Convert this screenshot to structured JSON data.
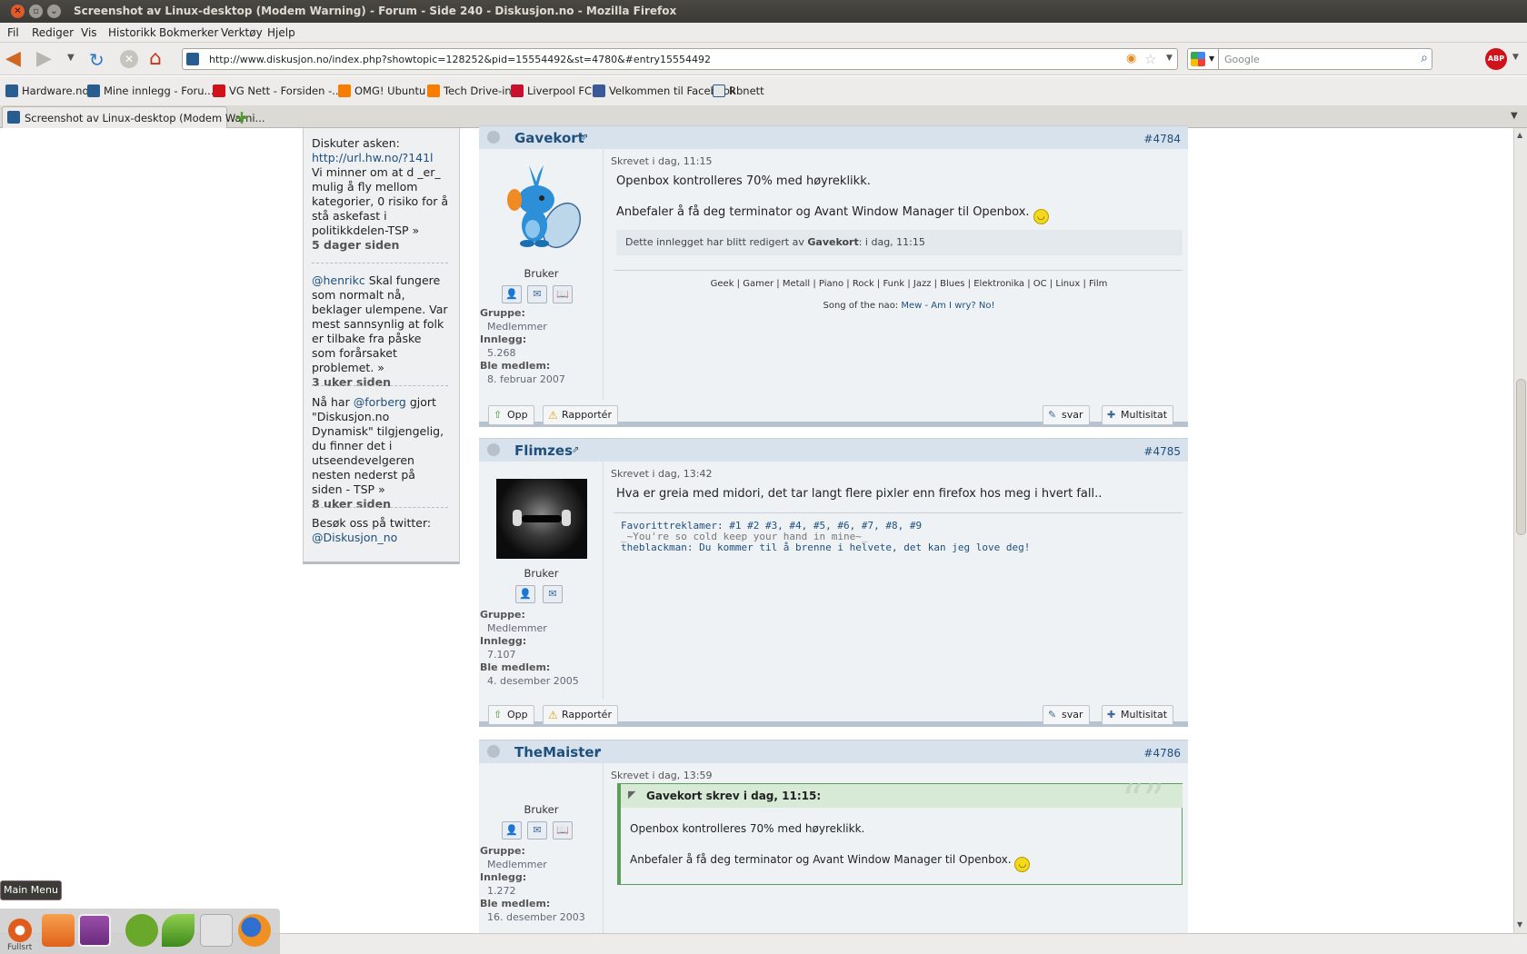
{
  "window": {
    "title": "Screenshot av Linux-desktop (Modem Warning) - Forum - Side 240 - Diskusjon.no - Mozilla Firefox"
  },
  "menu": [
    "Fil",
    "Rediger",
    "Vis",
    "Historikk",
    "Bokmerker",
    "Verktøy",
    "Hjelp"
  ],
  "nav": {
    "url": "http://www.diskusjon.no/index.php?showtopic=128252&pid=15554492&st=4780&#entry15554492",
    "search_placeholder": "Google"
  },
  "bookmarks": [
    "Hardware.no",
    "Mine innlegg - Foru...",
    "VG Nett - Forsiden -...",
    "OMG! Ubuntu!",
    "Tech Drive-in",
    "Liverpool FC",
    "Velkommen til Facebook",
    "Rbnett"
  ],
  "tab": {
    "label": "Screenshot av Linux-desktop (Modem Warni..."
  },
  "sidebar": {
    "b1_intro": "Diskuter asken:",
    "b1_link": "http://url.hw.no/?141l",
    "b1_text": "Vi minner om at d _er_ mulig å fly mellom kategorier, 0 risiko for å stå askefast i politikkdelen-TSP »",
    "b1_ago": "5 dager siden",
    "b2_mention": "@henrikc",
    "b2_text": "Skal fungere som normalt nå, beklager ulempene. Var mest sannsynlig at folk er tilbake fra påske som forårsaket problemet. »",
    "b2_ago": "3 uker siden",
    "b3_pre": "Nå har",
    "b3_mention": "@forberg",
    "b3_text": "gjort \"Diskusjon.no Dynamisk\" tilgjengelig, du finner det i utseendevelgeren nesten nederst på siden - TSP »",
    "b3_ago": "8 uker siden",
    "b4_text": "Besøk oss på twitter:",
    "b4_link": "@Diskusjon_no"
  },
  "labels": {
    "group": "Gruppe:",
    "posts": "Innlegg:",
    "joined": "Ble medlem:",
    "role": "Bruker",
    "group_val": "Medlemmer",
    "up": "Opp",
    "report": "Rapportér",
    "reply": "svar",
    "multi": "Multisitat"
  },
  "posts": [
    {
      "user": "Gavekort",
      "num": "#4784",
      "written": "Skrevet i dag, 11:15",
      "line1": "Openbox kontrolleres 70% med høyreklikk.",
      "line2": "Anbefaler å få deg terminator og Avant Window Manager til Openbox.",
      "edited_pre": "Dette innlegget har blitt redigert av",
      "edited_by": "Gavekort",
      "edited_post": ": i dag, 11:15",
      "sig1": "Geek | Gamer | Metall | Piano | Rock | Funk | Jazz | Blues | Elektronika | OC | Linux | Film",
      "sig2_pre": "Song of the nao:",
      "sig2_link": "Mew - Am I wry? No!",
      "posts_count": "5.268",
      "joined": "8. februar 2007"
    },
    {
      "user": "Flimzes",
      "num": "#4785",
      "written": "Skrevet i dag, 13:42",
      "line1": "Hva er greia med midori, det tar langt flere pixler enn firefox hos meg i hvert fall..",
      "sig_fav": "Favorittreklamer: #1 #2 #3, #4, #5, #6, #7, #8, #9",
      "sig_quote": "_~You're so cold keep your hand in mine~_",
      "sig_line": "theblackman: Du kommer til å brenne i helvete, det kan jeg love deg!",
      "posts_count": "7.107",
      "joined": "4. desember 2005"
    },
    {
      "user": "TheMaister",
      "num": "#4786",
      "written": "Skrevet i dag, 13:59",
      "quote_hdr": "Gavekort skrev i dag, 11:15:",
      "q1": "Openbox kontrolleres 70% med høyreklikk.",
      "q2": "Anbefaler å få deg terminator og Avant Window Manager til Openbox.",
      "posts_count": "1.272",
      "joined": "16. desember 2003"
    }
  ],
  "taskbar": {
    "mainmenu": "Main Menu",
    "fullskjerm": "Fullsrt"
  }
}
